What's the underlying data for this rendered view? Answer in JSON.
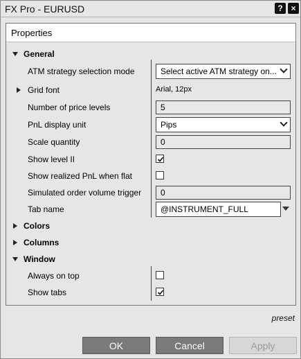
{
  "window": {
    "title": "FX Pro - EURUSD",
    "help_label": "?",
    "close_label": "×"
  },
  "panel": {
    "header": "Properties"
  },
  "general": {
    "label": "General",
    "atm_mode": {
      "label": "ATM strategy selection mode",
      "value": "Select active ATM strategy on..."
    },
    "grid_font": {
      "label": "Grid font",
      "value": "Arial, 12px"
    },
    "price_levels": {
      "label": "Number of price levels",
      "value": "5"
    },
    "pnl_unit": {
      "label": "PnL display unit",
      "value": "Pips"
    },
    "scale_qty": {
      "label": "Scale quantity",
      "value": "0"
    },
    "show_level2": {
      "label": "Show level II",
      "checked": true
    },
    "show_realized": {
      "label": "Show realized PnL when flat",
      "checked": false
    },
    "sim_trigger": {
      "label": "Simulated order volume trigger",
      "value": "0"
    },
    "tab_name": {
      "label": "Tab name",
      "value": "@INSTRUMENT_FULL"
    }
  },
  "colors": {
    "label": "Colors"
  },
  "columns": {
    "label": "Columns"
  },
  "window_section": {
    "label": "Window",
    "always_on_top": {
      "label": "Always on top",
      "checked": false
    },
    "show_tabs": {
      "label": "Show tabs",
      "checked": true
    }
  },
  "footer": {
    "preset": "preset",
    "ok": "OK",
    "cancel": "Cancel",
    "apply": "Apply"
  }
}
